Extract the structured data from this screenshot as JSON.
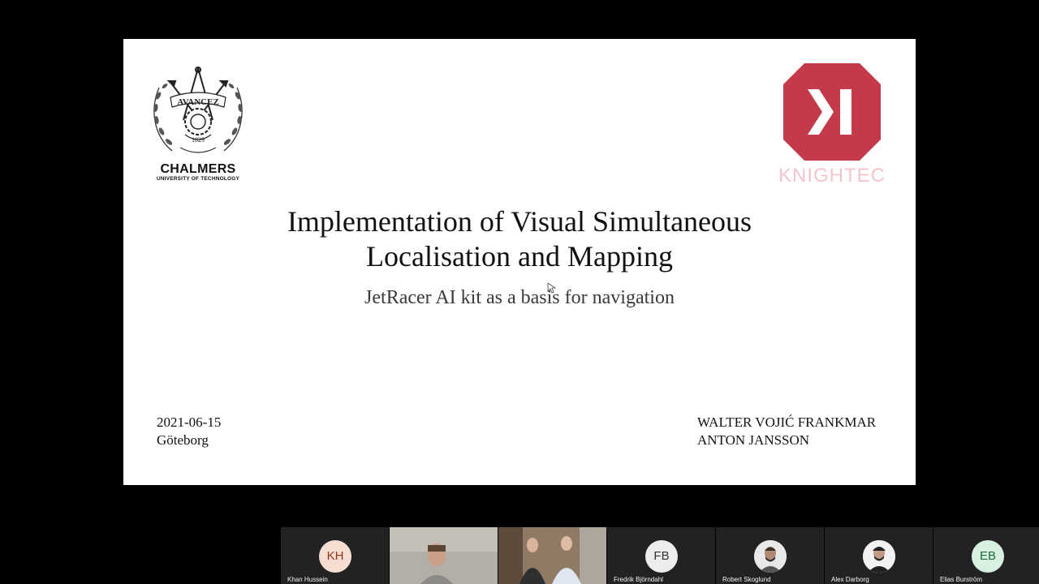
{
  "slide": {
    "chalmers": {
      "name": "CHALMERS",
      "subtitle": "UNIVERSITY OF TECHNOLOGY",
      "seal_text": "AVANCEZ",
      "seal_year": "1829"
    },
    "knightec": {
      "wordmark": "KNIGHTEC",
      "brand_color": "#c43a4b"
    },
    "title_line1": "Implementation of Visual Simultaneous",
    "title_line2": "Localisation and Mapping",
    "subtitle": "JetRacer AI kit as a basis for navigation",
    "date": "2021-06-15",
    "location": "Göteborg",
    "author1": "WALTER VOJIĆ FRANKMAR",
    "author2": "ANTON JANSSON"
  },
  "participants": [
    {
      "initials": "KH",
      "name": "Khan Hussein",
      "avatar_bg": "#f6ddd2",
      "avatar_fg": "#8c3a1c"
    },
    {
      "name": "",
      "type": "video"
    },
    {
      "name": "",
      "type": "video"
    },
    {
      "initials": "FB",
      "name": "Fredrik Björndahl",
      "avatar_bg": "#ededed",
      "avatar_fg": "#333333"
    },
    {
      "name": "Robert Skoglund",
      "type": "photo"
    },
    {
      "name": "Alex Darborg",
      "type": "photo"
    },
    {
      "initials": "EB",
      "name": "Elias Burström",
      "avatar_bg": "#d7f0df",
      "avatar_fg": "#1f6b3a"
    }
  ]
}
